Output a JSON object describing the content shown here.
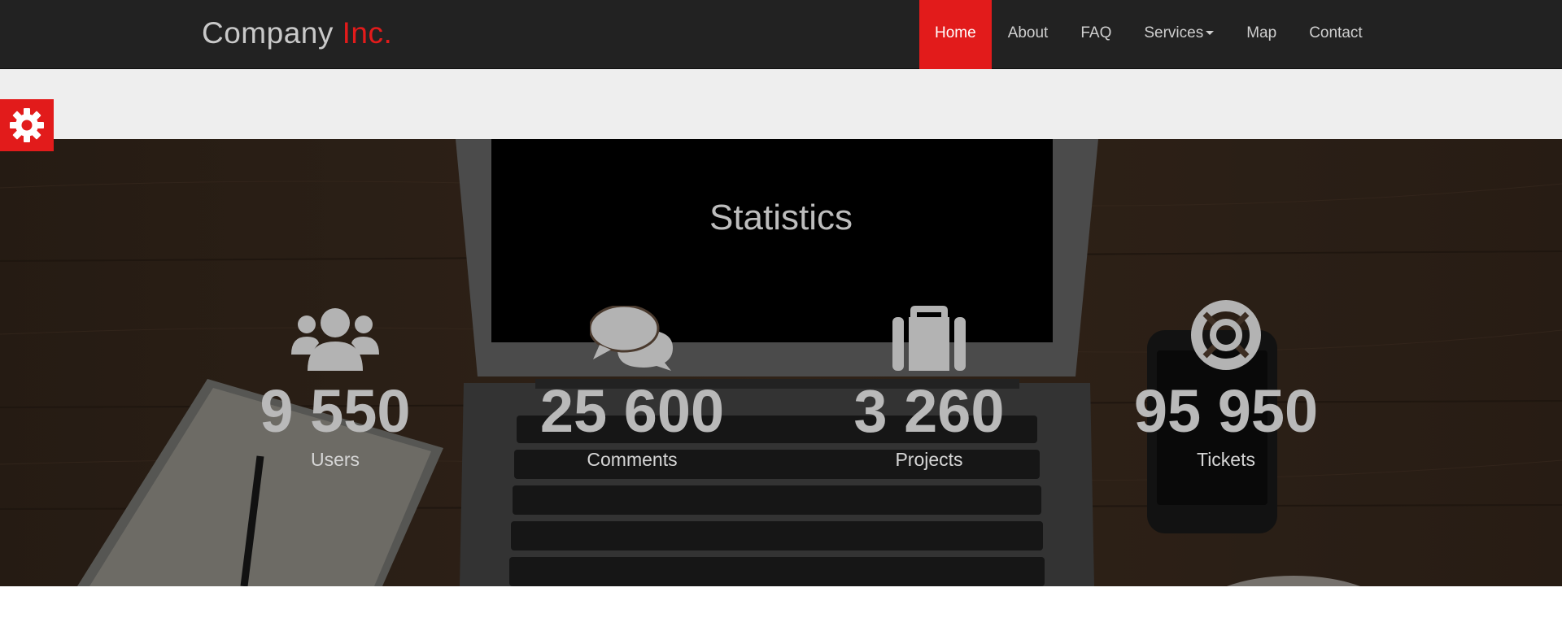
{
  "brand": {
    "name": "Company",
    "suffix": "Inc."
  },
  "nav": {
    "items": [
      {
        "label": "Home",
        "active": true
      },
      {
        "label": "About"
      },
      {
        "label": "FAQ"
      },
      {
        "label": "Services",
        "has_dropdown": true
      },
      {
        "label": "Map"
      },
      {
        "label": "Contact"
      }
    ]
  },
  "settings": {
    "icon": "gear-icon"
  },
  "statistics": {
    "title": "Statistics",
    "items": [
      {
        "icon": "users-icon",
        "value": "9 550",
        "label": "Users"
      },
      {
        "icon": "comments-icon",
        "value": "25 600",
        "label": "Comments"
      },
      {
        "icon": "briefcase-icon",
        "value": "3 260",
        "label": "Projects"
      },
      {
        "icon": "life-ring-icon",
        "value": "95 950",
        "label": "Tickets"
      }
    ]
  },
  "colors": {
    "accent": "#e21b1b",
    "navbar": "#222222",
    "band": "#eeeeee"
  }
}
